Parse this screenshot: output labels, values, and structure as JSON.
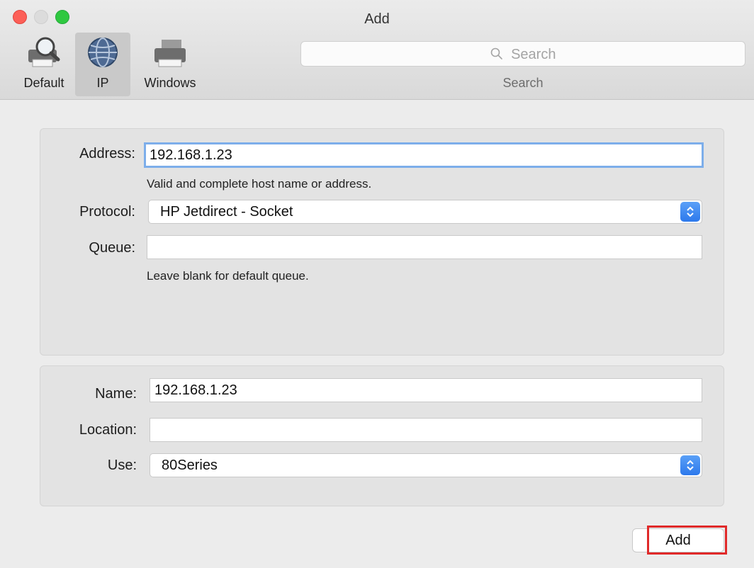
{
  "window": {
    "title": "Add"
  },
  "toolbar": {
    "items": [
      {
        "label": "Default",
        "icon": "printer-magnifier-icon"
      },
      {
        "label": "IP",
        "icon": "globe-icon",
        "selected": true
      },
      {
        "label": "Windows",
        "icon": "printer-icon"
      }
    ],
    "search": {
      "placeholder": "Search",
      "label": "Search"
    }
  },
  "ip_panel": {
    "address_label": "Address:",
    "address_value": "192.168.1.23",
    "address_hint": "Valid and complete host name or address.",
    "protocol_label": "Protocol:",
    "protocol_value": "HP Jetdirect - Socket",
    "queue_label": "Queue:",
    "queue_value": "",
    "queue_hint": "Leave blank for default queue."
  },
  "printer_panel": {
    "name_label": "Name:",
    "name_value": "192.168.1.23",
    "location_label": "Location:",
    "location_value": "",
    "use_label": "Use:",
    "use_value": "80Series"
  },
  "actions": {
    "add_label": "Add"
  },
  "colors": {
    "accent": "#2d79ec",
    "highlight": "#e02a2a"
  }
}
